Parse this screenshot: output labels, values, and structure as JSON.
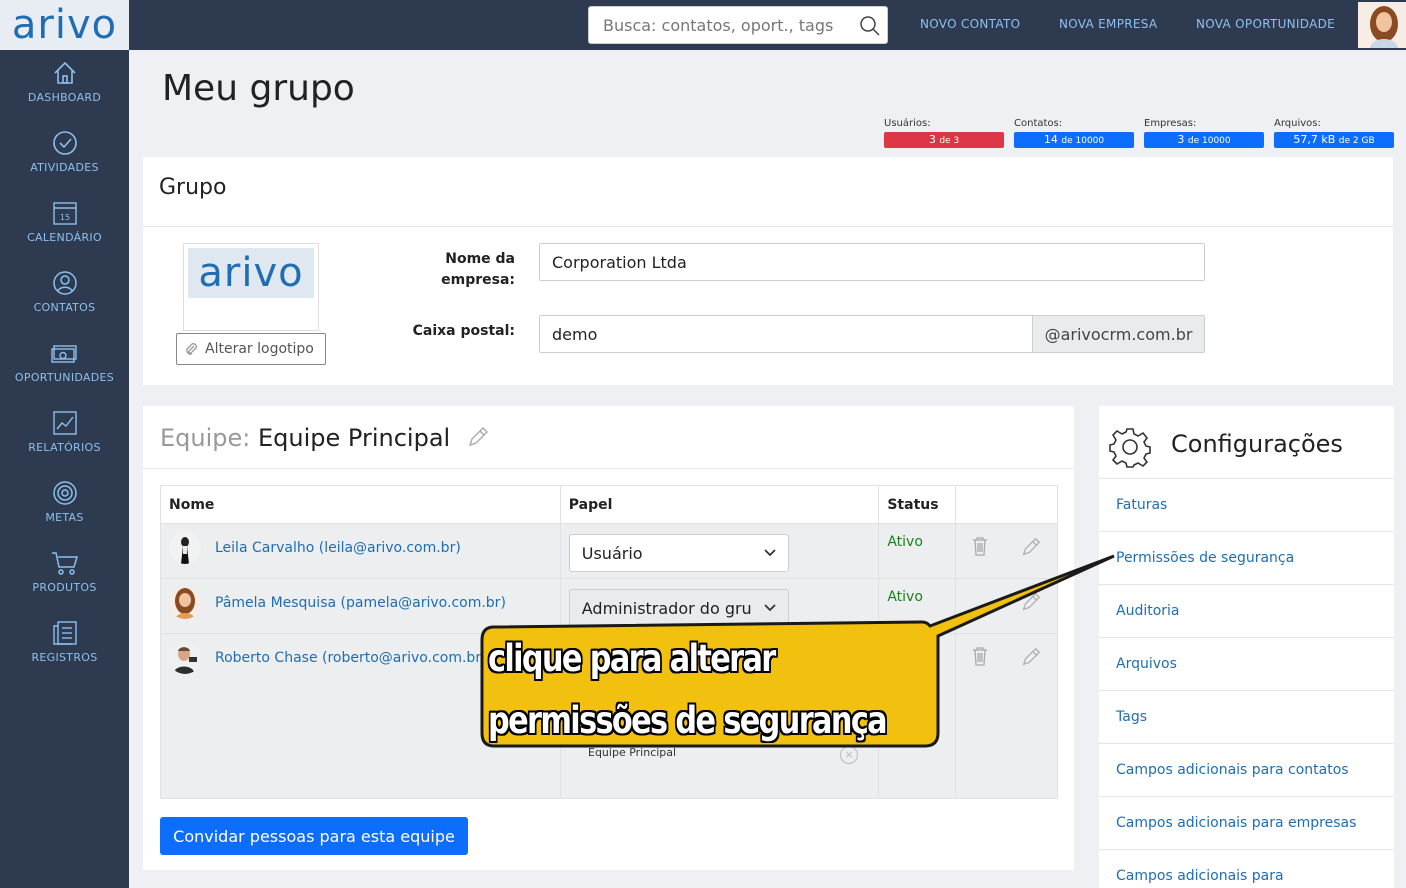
{
  "app": {
    "logo_text": "arivo"
  },
  "sidebar": {
    "items": [
      {
        "label": "DASHBOARD",
        "icon": "home-icon"
      },
      {
        "label": "ATIVIDADES",
        "icon": "check-circle-icon"
      },
      {
        "label": "CALENDÁRIO",
        "icon": "calendar-icon",
        "day": "15"
      },
      {
        "label": "CONTATOS",
        "icon": "person-icon"
      },
      {
        "label": "OPORTUNIDADES",
        "icon": "money-icon"
      },
      {
        "label": "RELATÓRIOS",
        "icon": "chart-icon"
      },
      {
        "label": "METAS",
        "icon": "target-icon"
      },
      {
        "label": "PRODUTOS",
        "icon": "cart-icon"
      },
      {
        "label": "REGISTROS",
        "icon": "records-icon"
      }
    ]
  },
  "topbar": {
    "search_placeholder": "Busca: contatos, oport., tags",
    "links": [
      "NOVO CONTATO",
      "NOVA EMPRESA",
      "NOVA OPORTUNIDADE"
    ]
  },
  "page": {
    "title": "Meu grupo"
  },
  "quotas": [
    {
      "label": "Usuários:",
      "value": "3",
      "of": "de 3",
      "color": "#dc3545"
    },
    {
      "label": "Contatos:",
      "value": "14",
      "of": "de 10000",
      "color": "#0d6efd"
    },
    {
      "label": "Empresas:",
      "value": "3",
      "of": "de 10000",
      "color": "#0d6efd"
    },
    {
      "label": "Arquivos:",
      "value": "57,7 kB",
      "of": "de 2 GB",
      "color": "#0d6efd"
    }
  ],
  "group": {
    "title": "Grupo",
    "logo_text": "arivo",
    "change_logo": "Alterar logotipo",
    "company_label_1": "Nome da",
    "company_label_2": "empresa:",
    "company_value": "Corporation Ltda",
    "mailbox_label": "Caixa postal:",
    "mailbox_value": "demo",
    "mailbox_domain": "@arivocrm.com.br"
  },
  "team": {
    "prefix": "Equipe:",
    "name": "Equipe Principal",
    "columns": [
      "Nome",
      "Papel",
      "Status"
    ],
    "members": [
      {
        "name": "Leila Carvalho (leila@arivo.com.br)",
        "role": "Usuário",
        "status": "Ativo"
      },
      {
        "name": "Pâmela Mesquisa (pamela@arivo.com.br)",
        "role": "Administrador do gru",
        "status": "Ativo"
      },
      {
        "name": "Roberto Chase (roberto@arivo.com.br)",
        "role": "",
        "status": ""
      }
    ],
    "expanded_team_label": "Equipe Principal",
    "invite_label": "Convidar pessoas para esta equipe"
  },
  "settings": {
    "title": "Configurações",
    "items": [
      "Faturas",
      "Permissões de segurança",
      "Auditoria",
      "Arquivos",
      "Tags",
      "Campos adicionais para contatos",
      "Campos adicionais para empresas",
      "Campos adicionais para"
    ]
  },
  "callout": {
    "line1": "clique para alterar",
    "line2": "permissões de segurança",
    "color": "#f2c10f"
  }
}
